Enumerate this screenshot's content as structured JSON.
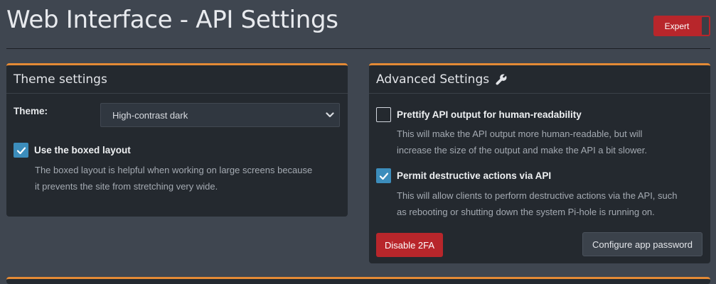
{
  "page": {
    "title": "Web Interface - API Settings"
  },
  "expert_toggle": {
    "label": "Expert",
    "state": "on",
    "color": "#b8262b"
  },
  "theme_settings": {
    "header": "Theme settings",
    "theme_label": "Theme:",
    "theme_select_value": "High-contrast dark",
    "boxed_layout": {
      "checked": true,
      "label": "Use the boxed layout",
      "help_line1": "The boxed layout is helpful when working on large screens because",
      "help_line2": "it prevents the site from stretching very wide."
    }
  },
  "advanced_settings": {
    "header": "Advanced Settings",
    "header_icon": "wrench-icon",
    "prettify": {
      "checked": false,
      "label": "Prettify API output for human-readability",
      "help_line1": "This will make the API output more human-readable, but will",
      "help_line2": "increase the size of the output and make the API a bit slower."
    },
    "destructive": {
      "checked": true,
      "label": "Permit destructive actions via API",
      "help_line1": "This will allow clients to perform destructive actions via the API, such",
      "help_line2": "as rebooting or shutting down the system Pi-hole is running on."
    },
    "disable_2fa_label": "Disable 2FA",
    "configure_app_password_label": "Configure app password"
  },
  "colors": {
    "accent_orange": "#e48a35",
    "checkbox_blue": "#3c8dbc",
    "danger_red": "#b8262b",
    "background": "#3f4650",
    "panel": "#24292f"
  }
}
